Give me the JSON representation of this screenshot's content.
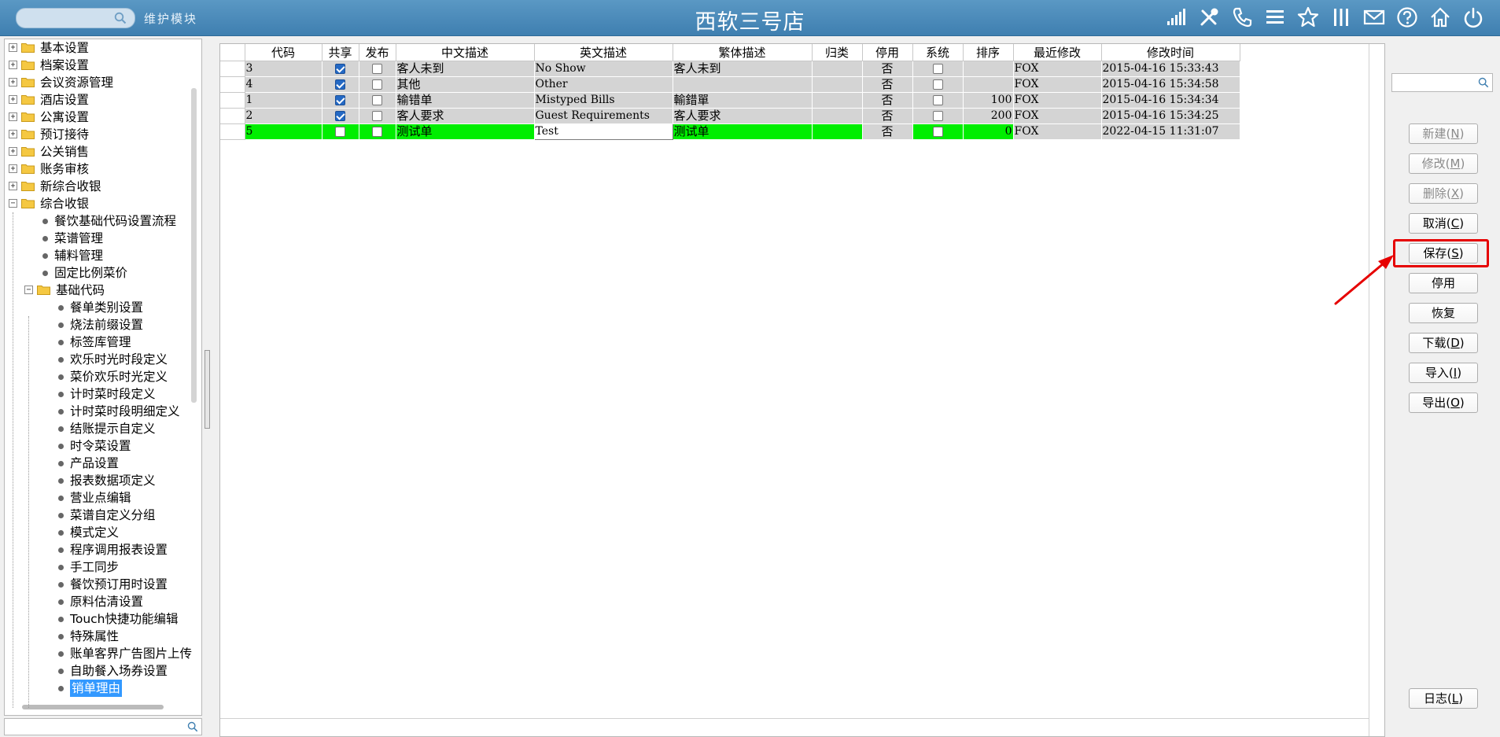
{
  "header": {
    "search_placeholder": "",
    "module_label": "维护模块",
    "title": "西软三号店",
    "icons": [
      "signal-icon",
      "tools-icon",
      "phone-icon",
      "menu-icon",
      "star-icon",
      "columns-icon",
      "mail-icon",
      "help-icon",
      "home-icon",
      "power-icon"
    ]
  },
  "tree": {
    "items": [
      {
        "label": "基本设置",
        "level": 0,
        "type": "folder",
        "expanded": false
      },
      {
        "label": "档案设置",
        "level": 0,
        "type": "folder",
        "expanded": false
      },
      {
        "label": "会议资源管理",
        "level": 0,
        "type": "folder",
        "expanded": false
      },
      {
        "label": "酒店设置",
        "level": 0,
        "type": "folder",
        "expanded": false
      },
      {
        "label": "公寓设置",
        "level": 0,
        "type": "folder",
        "expanded": false
      },
      {
        "label": "预订接待",
        "level": 0,
        "type": "folder",
        "expanded": false
      },
      {
        "label": "公关销售",
        "level": 0,
        "type": "folder",
        "expanded": false
      },
      {
        "label": "账务审核",
        "level": 0,
        "type": "folder",
        "expanded": false
      },
      {
        "label": "新综合收银",
        "level": 0,
        "type": "folder",
        "expanded": false
      },
      {
        "label": "综合收银",
        "level": 0,
        "type": "folder",
        "expanded": true
      },
      {
        "label": "餐饮基础代码设置流程",
        "level": 1,
        "type": "leaf"
      },
      {
        "label": "菜谱管理",
        "level": 1,
        "type": "leaf"
      },
      {
        "label": "辅料管理",
        "level": 1,
        "type": "leaf"
      },
      {
        "label": "固定比例菜价",
        "level": 1,
        "type": "leaf"
      },
      {
        "label": "基础代码",
        "level": 1,
        "type": "folder",
        "expanded": true
      },
      {
        "label": "餐单类别设置",
        "level": 2,
        "type": "leaf"
      },
      {
        "label": "烧法前缀设置",
        "level": 2,
        "type": "leaf"
      },
      {
        "label": "标签库管理",
        "level": 2,
        "type": "leaf"
      },
      {
        "label": "欢乐时光时段定义",
        "level": 2,
        "type": "leaf"
      },
      {
        "label": "菜价欢乐时光定义",
        "level": 2,
        "type": "leaf"
      },
      {
        "label": "计时菜时段定义",
        "level": 2,
        "type": "leaf"
      },
      {
        "label": "计时菜时段明细定义",
        "level": 2,
        "type": "leaf"
      },
      {
        "label": "结账提示自定义",
        "level": 2,
        "type": "leaf"
      },
      {
        "label": "时令菜设置",
        "level": 2,
        "type": "leaf"
      },
      {
        "label": "产品设置",
        "level": 2,
        "type": "leaf"
      },
      {
        "label": "报表数据项定义",
        "level": 2,
        "type": "leaf"
      },
      {
        "label": "营业点编辑",
        "level": 2,
        "type": "leaf"
      },
      {
        "label": "菜谱自定义分组",
        "level": 2,
        "type": "leaf"
      },
      {
        "label": "模式定义",
        "level": 2,
        "type": "leaf"
      },
      {
        "label": "程序调用报表设置",
        "level": 2,
        "type": "leaf"
      },
      {
        "label": "手工同步",
        "level": 2,
        "type": "leaf"
      },
      {
        "label": "餐饮预订用时设置",
        "level": 2,
        "type": "leaf"
      },
      {
        "label": "原料估清设置",
        "level": 2,
        "type": "leaf"
      },
      {
        "label": "Touch快捷功能编辑",
        "level": 2,
        "type": "leaf"
      },
      {
        "label": "特殊属性",
        "level": 2,
        "type": "leaf"
      },
      {
        "label": "账单客界广告图片上传",
        "level": 2,
        "type": "leaf"
      },
      {
        "label": "自助餐入场券设置",
        "level": 2,
        "type": "leaf"
      },
      {
        "label": "销单理由",
        "level": 2,
        "type": "leaf",
        "selected": true
      }
    ]
  },
  "grid": {
    "columns": [
      "代码",
      "共享",
      "发布",
      "中文描述",
      "英文描述",
      "繁体描述",
      "归类",
      "停用",
      "系统",
      "排序",
      "最近修改",
      "修改时间"
    ],
    "rows": [
      {
        "code": "3",
        "shared": true,
        "publish": false,
        "cn": "客人未到",
        "en": "No Show",
        "tw": "客人未到",
        "cat": "",
        "disabled": "否",
        "system": false,
        "sort": "",
        "modifier": "FOX",
        "time": "2015-04-16 15:33:43",
        "highlight": false
      },
      {
        "code": "4",
        "shared": true,
        "publish": false,
        "cn": "其他",
        "en": "Other",
        "tw": "",
        "cat": "",
        "disabled": "否",
        "system": false,
        "sort": "",
        "modifier": "FOX",
        "time": "2015-04-16 15:34:58",
        "highlight": false
      },
      {
        "code": "1",
        "shared": true,
        "publish": false,
        "cn": "输错单",
        "en": "Mistyped Bills",
        "tw": "輸錯單",
        "cat": "",
        "disabled": "否",
        "system": false,
        "sort": "100",
        "modifier": "FOX",
        "time": "2015-04-16 15:34:34",
        "highlight": false
      },
      {
        "code": "2",
        "shared": true,
        "publish": false,
        "cn": "客人要求",
        "en": "Guest Requirements",
        "tw": "客人要求",
        "cat": "",
        "disabled": "否",
        "system": false,
        "sort": "200",
        "modifier": "FOX",
        "time": "2015-04-16 15:34:25",
        "highlight": false
      },
      {
        "code": "5",
        "shared": false,
        "publish": false,
        "cn": "测试单",
        "en": "Test",
        "tw": "测试单",
        "cat": "",
        "disabled": "否",
        "system": false,
        "sort": "0",
        "modifier": "FOX",
        "time": "2022-04-15 11:31:07",
        "highlight": true
      }
    ]
  },
  "buttons": {
    "new": {
      "label": "新建(",
      "key": "N",
      "end": ")",
      "enabled": false
    },
    "modify": {
      "label": "修改(",
      "key": "M",
      "end": ")",
      "enabled": false
    },
    "delete": {
      "label": "删除(",
      "key": "X",
      "end": ")",
      "enabled": false
    },
    "cancel": {
      "label": "取消(",
      "key": "C",
      "end": ")",
      "enabled": true
    },
    "save": {
      "label": "保存(",
      "key": "S",
      "end": ")",
      "enabled": true
    },
    "disable": {
      "label": "停用",
      "key": "",
      "end": "",
      "enabled": true
    },
    "restore": {
      "label": "恢复",
      "key": "",
      "end": "",
      "enabled": true
    },
    "download": {
      "label": "下载(",
      "key": "D",
      "end": ")",
      "enabled": true
    },
    "import": {
      "label": "导入(",
      "key": "I",
      "end": ")",
      "enabled": true
    },
    "export": {
      "label": "导出(",
      "key": "O",
      "end": ")",
      "enabled": true
    },
    "log": {
      "label": "日志(",
      "key": "L",
      "end": ")",
      "enabled": true
    }
  },
  "colors": {
    "topbar": "#4a8bbb",
    "highlight_row": "#00ee00",
    "selected_tree": "#3399ff",
    "annotation": "#e60000"
  }
}
